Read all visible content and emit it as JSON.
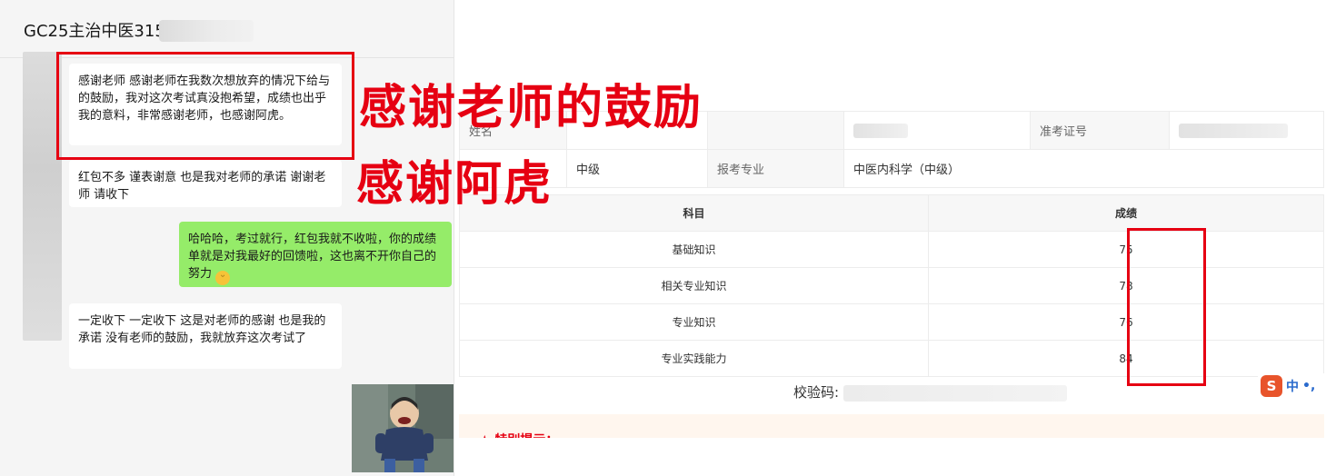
{
  "chat": {
    "title": "GC25主治中医315",
    "messages": [
      {
        "side": "in",
        "text": "感谢老师   感谢老师在我数次想放弃的情况下给与的鼓励，我对这次考试真没抱希望，成绩也出乎我的意料，非常感谢老师，也感谢阿虎。"
      },
      {
        "side": "in",
        "text": "红包不多  谨表谢意   也是我对老师的承诺  谢谢老师  请收下"
      },
      {
        "side": "out",
        "text": "哈哈哈，考过就行，红包我就不收啦，你的成绩单就是对我最好的回馈啦，这也离不开你自己的努力",
        "emoji": "grin-emoji"
      },
      {
        "side": "in",
        "text": "一定收下  一定收下  这是对老师的感谢   也是我的承诺   没有老师的鼓励，我就放弃这次考试了"
      }
    ]
  },
  "overlay": {
    "line1": "感谢老师的鼓励",
    "line2": "感谢阿虎"
  },
  "score_page": {
    "info": {
      "name_label": "姓名",
      "id_label": "准考证号",
      "level_value": "中级",
      "major_label": "报考专业",
      "major_value": "中医内科学（中级）"
    },
    "table": {
      "headers": [
        "科目",
        "成绩"
      ],
      "rows": [
        {
          "subject": "基础知识",
          "score": "75"
        },
        {
          "subject": "相关专业知识",
          "score": "78"
        },
        {
          "subject": "专业知识",
          "score": "76"
        },
        {
          "subject": "专业实践能力",
          "score": "84"
        }
      ]
    },
    "verify_label": "校验码:",
    "notice": "★  特别提示："
  },
  "ime": {
    "logo": "S",
    "lang": "中",
    "punct": "•,"
  },
  "colors": {
    "highlight_red": "#e60012",
    "bubble_green": "#95ec69",
    "chat_bg": "#f5f5f5"
  }
}
